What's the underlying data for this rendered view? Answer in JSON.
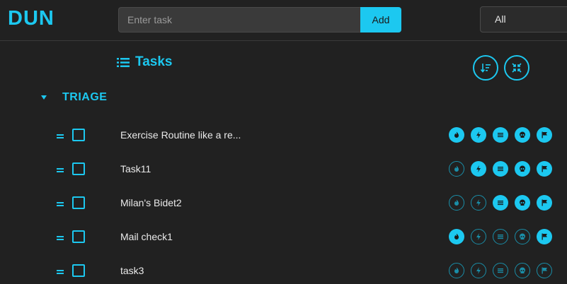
{
  "app": {
    "title": "DUN"
  },
  "header": {
    "task_placeholder": "Enter task",
    "add_label": "Add",
    "filter_value": "All"
  },
  "main": {
    "heading": "Tasks",
    "sort_icon": "sort-descending-icon",
    "collapse_icon": "collapse-arrows-icon"
  },
  "section": {
    "title": "TRIAGE",
    "caret_icon": "caret-down-icon"
  },
  "colors": {
    "accent": "#1cc8f0",
    "background": "#212121",
    "inactive_icon": "#1a8ea8"
  },
  "icon_types": [
    "fire-icon",
    "bolt-icon",
    "lines-icon",
    "skull-icon",
    "flag-icon"
  ],
  "tasks": [
    {
      "text": "Exercise Routine like a re...",
      "flags": [
        true,
        true,
        true,
        true,
        true
      ]
    },
    {
      "text": "Task11",
      "flags": [
        false,
        true,
        true,
        true,
        true
      ]
    },
    {
      "text": "Milan's Bidet2",
      "flags": [
        false,
        false,
        true,
        true,
        true
      ]
    },
    {
      "text": "Mail check1",
      "flags": [
        true,
        false,
        false,
        false,
        true
      ]
    },
    {
      "text": "task3",
      "flags": [
        false,
        false,
        false,
        false,
        false
      ]
    }
  ]
}
